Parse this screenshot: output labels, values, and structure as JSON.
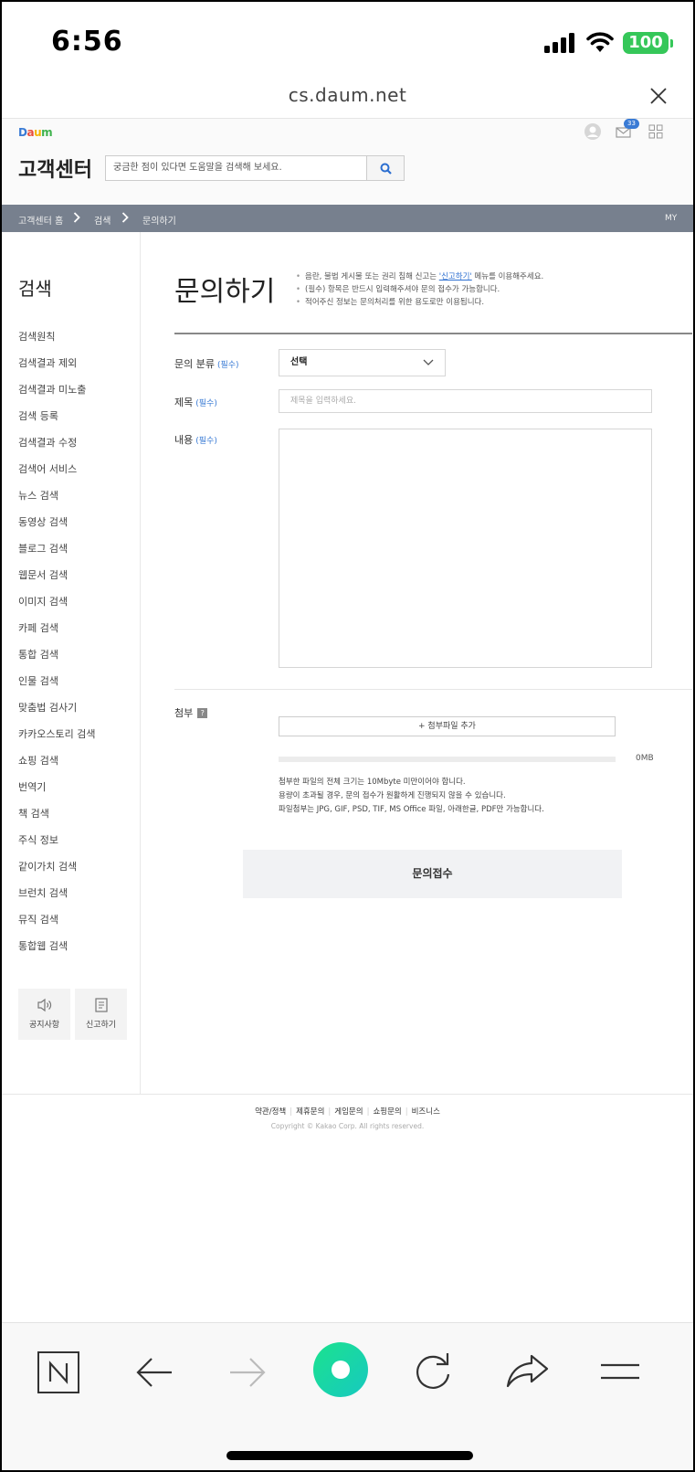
{
  "status_bar": {
    "time": "6:56",
    "battery": "100"
  },
  "browser": {
    "url": "cs.daum.net"
  },
  "header": {
    "logo": "Daum",
    "mail_badge": "33",
    "title": "고객센터",
    "search_placeholder": "궁금한 점이 있다면 도움말을 검색해 보세요."
  },
  "breadcrumb": {
    "items": [
      "고객센터 홈",
      "검색",
      "문의하기"
    ],
    "my": "MY"
  },
  "sidebar": {
    "title": "검색",
    "items": [
      "검색원칙",
      "검색결과 제외",
      "검색결과 미노출",
      "검색 등록",
      "검색결과 수정",
      "검색어 서비스",
      "뉴스 검색",
      "동영상 검색",
      "블로그 검색",
      "웹문서 검색",
      "이미지 검색",
      "카페 검색",
      "통합 검색",
      "인물 검색",
      "맞춤법 검사기",
      "카카오스토리 검색",
      "쇼핑 검색",
      "번역기",
      "책 검색",
      "주식 정보",
      "같이가치 검색",
      "브런치 검색",
      "뮤직 검색",
      "통합웹 검색"
    ],
    "boxes": [
      {
        "label": "공지사항",
        "icon": "speaker-icon"
      },
      {
        "label": "신고하기",
        "icon": "document-icon"
      }
    ]
  },
  "main": {
    "title": "문의하기",
    "notices": {
      "n1_pre": "음란, 불법 게시물 또는 권리 침해 신고는 ",
      "n1_link": "'신고하기'",
      "n1_post": " 메뉴를 이용해주세요.",
      "n2": "(필수) 항목은 반드시 입력해주셔야 문의 접수가 가능합니다.",
      "n3": "적어주신 정보는 문의처리를 위한 용도로만 이용됩니다."
    },
    "form": {
      "category_label": "문의 분류",
      "required": "(필수)",
      "category_value": "선택",
      "subject_label": "제목",
      "subject_placeholder": "제목을 입력하세요.",
      "content_label": "내용",
      "attach_label": "첨부",
      "attach_help": "?",
      "attach_button": "+ 첨부파일 추가",
      "attach_progress": 0,
      "attach_size": "0MB",
      "notes": [
        "첨부한 파일의 전체 크기는 10Mbyte 미만이어야 합니다.",
        "용량이 초과될 경우, 문의 접수가 원활하게 진행되지 않을 수 있습니다.",
        "파일첨부는 JPG, GIF, PSD, TIF, MS Office 파일, 아래한글, PDF만 가능합니다."
      ],
      "submit": "문의접수"
    }
  },
  "footer": {
    "links": [
      "약관/정책",
      "제휴문의",
      "게임문의",
      "쇼핑문의",
      "비즈니스"
    ],
    "copyright": "Copyright © Kakao Corp. All rights reserved."
  },
  "browser_toolbar": {
    "icons": [
      "naver-home-icon",
      "back-arrow-icon",
      "forward-arrow-icon",
      "green-dot-icon",
      "reload-icon",
      "share-icon",
      "menu-icon"
    ]
  },
  "colors": {
    "accent": "#3a7bd5",
    "breadcrumb_bg": "#77808e",
    "battery": "#35c759",
    "green_button": "#1ed99a"
  }
}
